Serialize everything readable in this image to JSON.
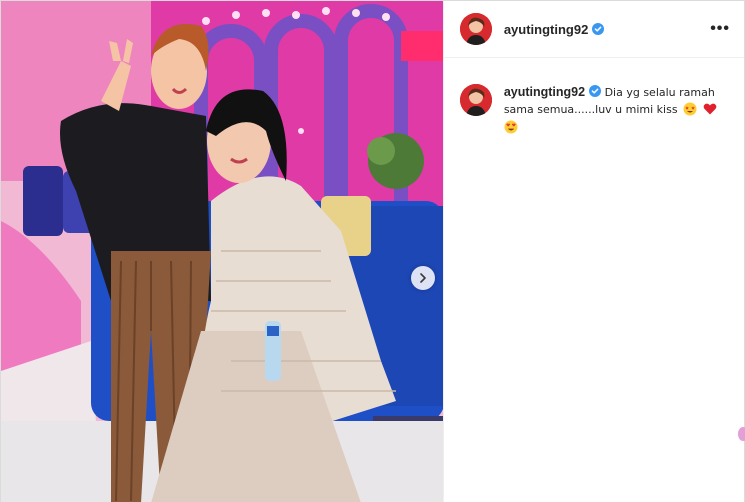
{
  "post": {
    "username": "ayutingting92",
    "verified": true,
    "more_label": "•••",
    "caption": "Dia yg selalu ramah sama semua......luv u mimi kiss",
    "caption_emojis": [
      "star-struck-face",
      "red-heart",
      "smiling-face-with-heart-eyes"
    ],
    "carousel_next_icon": "chevron-right-icon",
    "image_alt": "Two women posing on a pink TV studio set with a blue sofa"
  },
  "colors": {
    "verified_blue": "#3897f0",
    "text": "#262626",
    "border": "#dbdbdb"
  }
}
